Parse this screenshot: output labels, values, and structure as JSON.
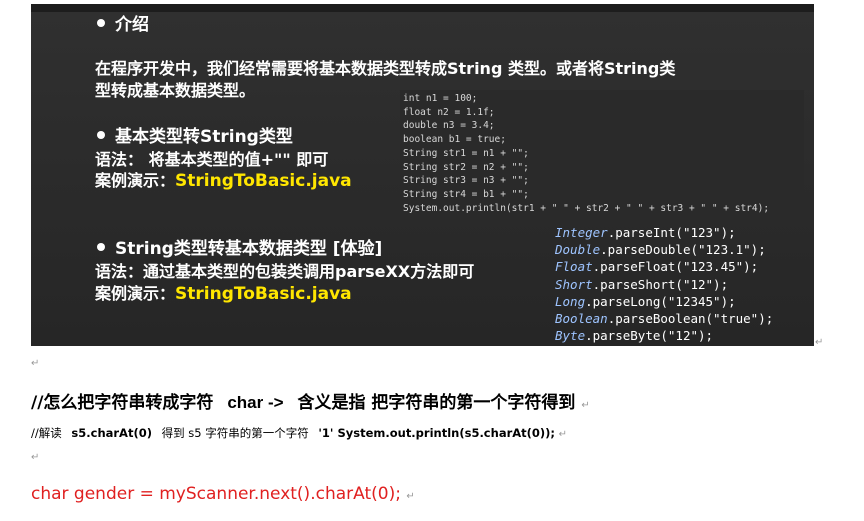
{
  "slide": {
    "intro_heading": "介绍",
    "intro_line1": "在程序开发中，我们经常需要将基本数据类型转成String 类型。或者将String类",
    "intro_line2": "型转成基本数据类型。",
    "section1": {
      "heading": "基本类型转String类型",
      "syntax": "语法： 将基本类型的值+\"\" 即可",
      "example_label": "案例演示：",
      "example_file": "StringToBasic.java"
    },
    "section2": {
      "heading": "String类型转基本数据类型 [体验]",
      "syntax": "语法：通过基本类型的包装类调用parseXX方法即可",
      "example_label": "案例演示：",
      "example_file": "StringToBasic.java"
    },
    "code_lines": [
      "int n1 = 100;",
      "float n2 = 1.1f;",
      "double n3 = 3.4;",
      "boolean b1 = true;",
      "String str1 = n1 + \"\";",
      "String str2 = n2 + \"\";",
      "String str3 = n3 + \"\";",
      "String str4 = b1 + \"\";",
      "System.out.println(str1 + \" \" + str2 + \" \" + str3 + \" \" + str4);"
    ],
    "parse_lines": [
      {
        "cls": "Integer",
        "rest": ".parseInt(\"123\");"
      },
      {
        "cls": "Double",
        "rest": ".parseDouble(\"123.1\");"
      },
      {
        "cls": "Float",
        "rest": ".parseFloat(\"123.45\");"
      },
      {
        "cls": "Short",
        "rest": ".parseShort(\"12\");"
      },
      {
        "cls": "Long",
        "rest": ".parseLong(\"12345\");"
      },
      {
        "cls": "Boolean",
        "rest": ".parseBoolean(\"true\");"
      },
      {
        "cls": "Byte",
        "rest": ".parseByte(\"12\");"
      }
    ]
  },
  "doc": {
    "line1_prefix": "//怎么把字符串转成字符",
    "line1_code": "char ->",
    "line1_suffix": "含义是指 把字符串的第一个字符得到",
    "line2_a": "//解读",
    "line2_b": "s5.charAt(0)",
    "line2_c": "得到 s5 字符串的第一个字符",
    "line2_d": "'1' System.out.println(s5.charAt(0));",
    "line3": "char gender = myScanner.next().charAt(0);",
    "para_mark": "↵"
  }
}
